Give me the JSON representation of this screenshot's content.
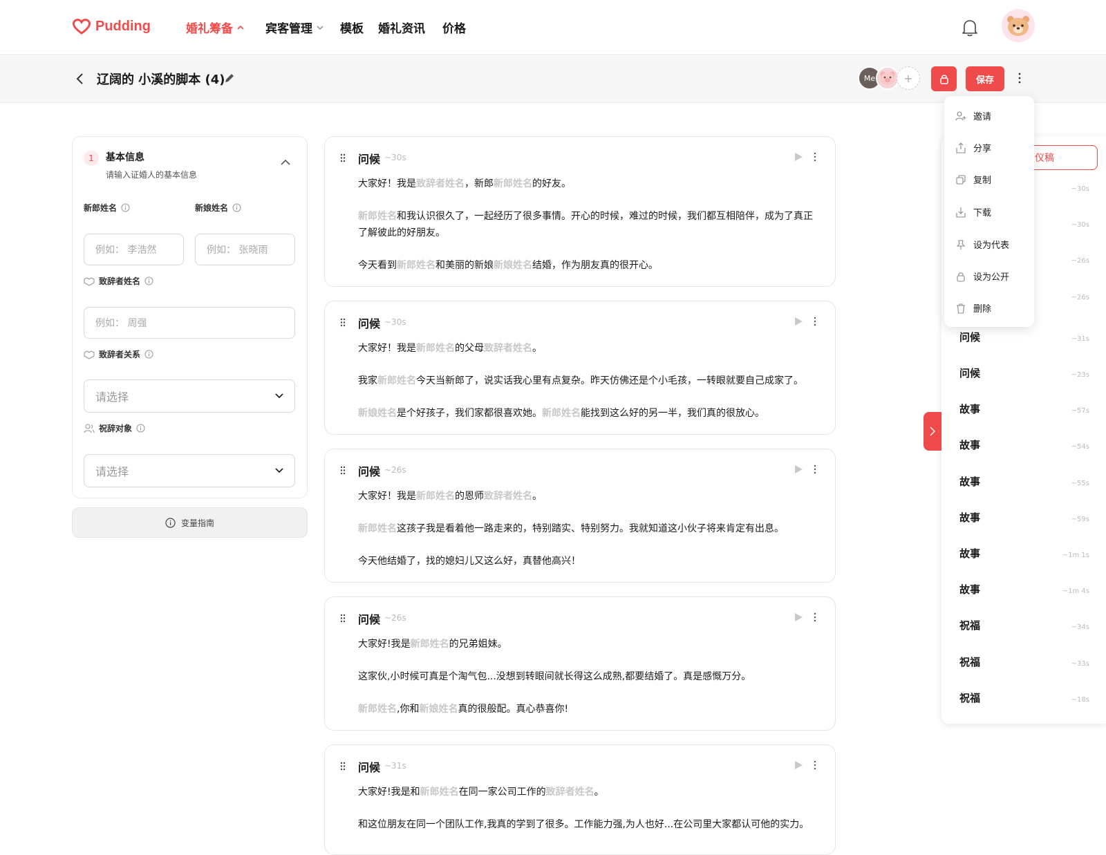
{
  "brand": {
    "name": "Pudding",
    "color": "#ef4b4b"
  },
  "nav": {
    "items": [
      {
        "label": "婚礼筹备",
        "active": true,
        "has_dropdown": true
      },
      {
        "label": "宾客管理",
        "active": false,
        "has_dropdown": true
      },
      {
        "label": "模板",
        "active": false,
        "has_dropdown": false
      },
      {
        "label": "婚礼资讯",
        "active": false,
        "has_dropdown": false
      },
      {
        "label": "价格",
        "active": false,
        "has_dropdown": false
      }
    ]
  },
  "header": {
    "title": "辽阔的 小溪的脚本 (4)",
    "collaborators": [
      {
        "label": "Me"
      },
      {
        "label": ""
      }
    ],
    "add_collaborator": "+",
    "save_label": "保存"
  },
  "menu": {
    "items": [
      {
        "label": "邀请",
        "icon": "invite-icon"
      },
      {
        "label": "分享",
        "icon": "share-icon"
      },
      {
        "label": "复制",
        "icon": "copy-icon"
      },
      {
        "label": "下载",
        "icon": "download-icon"
      },
      {
        "label": "设为代表",
        "icon": "pin-icon"
      },
      {
        "label": "设为公开",
        "icon": "unlock-icon"
      },
      {
        "label": "删除",
        "icon": "trash-icon"
      }
    ]
  },
  "form": {
    "step": "1",
    "title": "基本信息",
    "subtitle": "请输入证婚人的基本信息",
    "groom_label": "新郎姓名",
    "groom_placeholder": "例如： 李浩然",
    "bride_label": "新娘姓名",
    "bride_placeholder": "例如： 张晓雨",
    "speaker_label": "致辞者姓名",
    "speaker_placeholder": "例如： 周强",
    "relation_label": "致辞者关系",
    "relation_value": "请选择",
    "target_label": "祝辞对象",
    "target_value": "请选择",
    "guide_label": "变量指南"
  },
  "cards": [
    {
      "title": "问候",
      "duration": "~30s",
      "paragraphs": [
        [
          {
            "t": "大家好！我是"
          },
          {
            "v": "致辞者姓名"
          },
          {
            "t": "，新郎"
          },
          {
            "v": "新郎姓名"
          },
          {
            "t": "的好友。"
          }
        ],
        [
          {
            "v": "新郎姓名"
          },
          {
            "t": "和我认识很久了，一起经历了很多事情。开心的时候，难过的时候，我们都互相陪伴，成为了真正了解彼此的好朋友。"
          }
        ],
        [
          {
            "t": "今天看到"
          },
          {
            "v": "新郎姓名"
          },
          {
            "t": "和美丽的新娘"
          },
          {
            "v": "新娘姓名"
          },
          {
            "t": "结婚，作为朋友真的很开心。"
          }
        ]
      ]
    },
    {
      "title": "问候",
      "duration": "~30s",
      "paragraphs": [
        [
          {
            "t": "大家好！我是"
          },
          {
            "v": "新郎姓名"
          },
          {
            "t": "的父母"
          },
          {
            "v": "致辞者姓名"
          },
          {
            "t": "。"
          }
        ],
        [
          {
            "t": "我家"
          },
          {
            "v": "新郎姓名"
          },
          {
            "t": "今天当新郎了，说实话我心里有点复杂。昨天仿佛还是个小毛孩，一转眼就要自己成家了。"
          }
        ],
        [
          {
            "v": "新娘姓名"
          },
          {
            "t": "是个好孩子，我们家都很喜欢她。"
          },
          {
            "v": "新郎姓名"
          },
          {
            "t": "能找到这么好的另一半，我们真的很放心。"
          }
        ]
      ]
    },
    {
      "title": "问候",
      "duration": "~26s",
      "paragraphs": [
        [
          {
            "t": "大家好！我是"
          },
          {
            "v": "新郎姓名"
          },
          {
            "t": "的恩师"
          },
          {
            "v": "致辞者姓名"
          },
          {
            "t": "。"
          }
        ],
        [
          {
            "v": "新郎姓名"
          },
          {
            "t": "这孩子我是看着他一路走来的，特别踏实、特别努力。我就知道这小伙子将来肯定有出息。"
          }
        ],
        [
          {
            "t": "今天他结婚了，找的媳妇儿又这么好，真替他高兴！"
          }
        ]
      ]
    },
    {
      "title": "问候",
      "duration": "~26s",
      "paragraphs": [
        [
          {
            "t": "大家好!我是"
          },
          {
            "v": "新郎姓名"
          },
          {
            "t": "的兄弟姐妹。"
          }
        ],
        [
          {
            "t": "这家伙,小时候可真是个淘气包...没想到转眼间就长得这么成熟,都要结婚了。真是感慨万分。"
          }
        ],
        [
          {
            "v": "新郎姓名"
          },
          {
            "t": ",你和"
          },
          {
            "v": "新娘姓名"
          },
          {
            "t": "真的很般配。真心恭喜你!"
          }
        ]
      ]
    },
    {
      "title": "问候",
      "duration": "~31s",
      "paragraphs": [
        [
          {
            "t": "大家好!我是和"
          },
          {
            "v": "新郎姓名"
          },
          {
            "t": "在同一家公司工作的"
          },
          {
            "v": "致辞者姓名"
          },
          {
            "t": "。"
          }
        ],
        [
          {
            "t": "和这位朋友在同一个团队工作,我真的学到了很多。工作能力强,为人也好...在公司里大家都认可他的实力。"
          }
        ]
      ]
    }
  ],
  "outline": {
    "button_label": "仪稿",
    "items": [
      {
        "name": "",
        "duration": "~30s"
      },
      {
        "name": "",
        "duration": "~30s"
      },
      {
        "name": "",
        "duration": "~26s"
      },
      {
        "name": "",
        "duration": "~26s"
      },
      {
        "name": "问候",
        "duration": "~31s"
      },
      {
        "name": "问候",
        "duration": "~23s"
      },
      {
        "name": "故事",
        "duration": "~57s"
      },
      {
        "name": "故事",
        "duration": "~54s"
      },
      {
        "name": "故事",
        "duration": "~55s"
      },
      {
        "name": "故事",
        "duration": "~59s"
      },
      {
        "name": "故事",
        "duration": "~1m 1s"
      },
      {
        "name": "故事",
        "duration": "~1m 4s"
      },
      {
        "name": "祝福",
        "duration": "~34s"
      },
      {
        "name": "祝福",
        "duration": "~33s"
      },
      {
        "name": "祝福",
        "duration": "~18s"
      }
    ]
  }
}
